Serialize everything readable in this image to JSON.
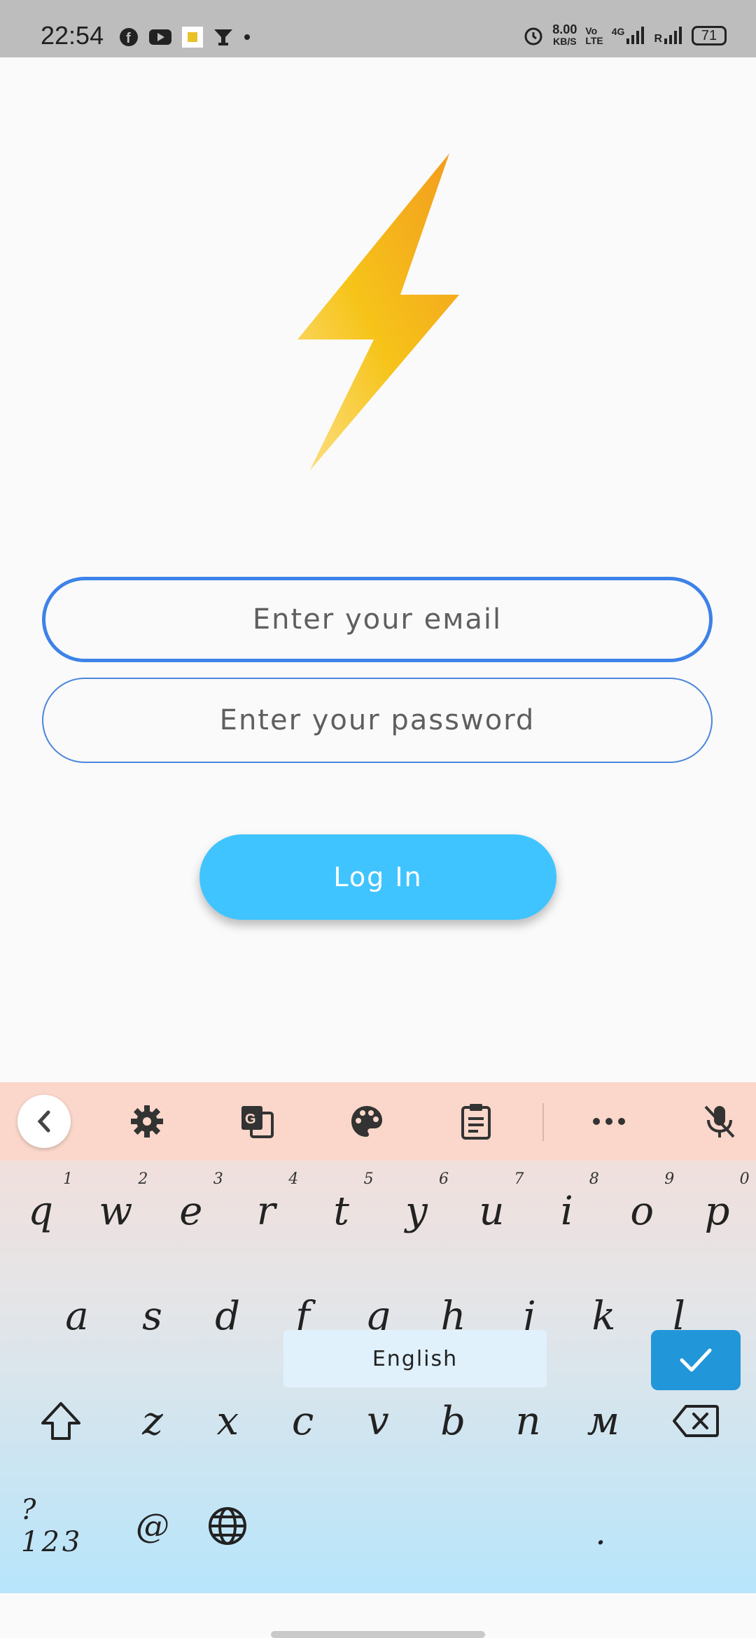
{
  "status_bar": {
    "time": "22:54",
    "speed_value": "8.00",
    "speed_unit": "KB/S",
    "volte_line1": "Vo",
    "volte_line2": "LTE",
    "network": "4G",
    "roaming": "R",
    "battery": "71",
    "notification_icons": [
      "facebook-icon",
      "youtube-icon",
      "app-icon",
      "cup-icon",
      "dot-icon"
    ]
  },
  "login": {
    "email_placeholder": "Enter your eмail",
    "password_placeholder": "Enter your password",
    "login_button": "Log In"
  },
  "keyboard": {
    "toolbar": [
      "back-icon",
      "gear-icon",
      "translate-icon",
      "palette-icon",
      "clipboard-icon",
      "more-icon",
      "mic-off-icon"
    ],
    "row1": [
      {
        "ch": "q",
        "num": "1"
      },
      {
        "ch": "w",
        "num": "2"
      },
      {
        "ch": "e",
        "num": "3"
      },
      {
        "ch": "r",
        "num": "4"
      },
      {
        "ch": "t",
        "num": "5"
      },
      {
        "ch": "y",
        "num": "6"
      },
      {
        "ch": "u",
        "num": "7"
      },
      {
        "ch": "i",
        "num": "8"
      },
      {
        "ch": "o",
        "num": "9"
      },
      {
        "ch": "p",
        "num": "0"
      }
    ],
    "row2": [
      "a",
      "s",
      "d",
      "f",
      "g",
      "h",
      "j",
      "k",
      "l"
    ],
    "row3": [
      "z",
      "x",
      "c",
      "v",
      "b",
      "n",
      "м"
    ],
    "symbols_key": "?123",
    "at_key": "@",
    "space_label": "English",
    "period_key": "."
  },
  "colors": {
    "accent": "#40c4ff",
    "field_border": "#4a86dc",
    "bolt": "#f5b31c",
    "enter_key": "#2196d9"
  }
}
